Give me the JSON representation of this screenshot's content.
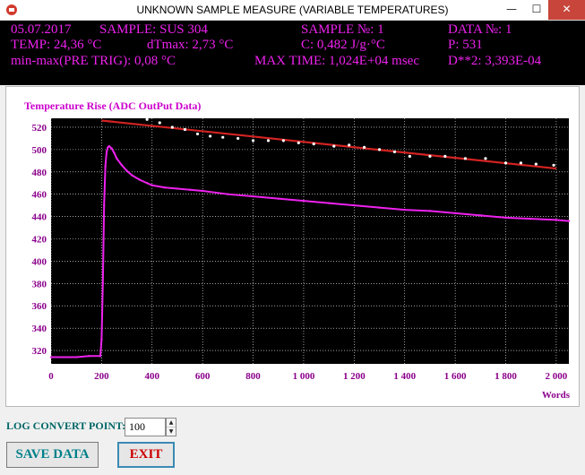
{
  "window": {
    "title": "UNKNOWN SAMPLE MEASURE (VARIABLE TEMPERATURES)",
    "controls": {
      "minimize": "—",
      "maximize": "☐",
      "close": "✕"
    }
  },
  "info": {
    "date": "05.07.2017",
    "sample": "SAMPLE: SUS 304",
    "sample_no": "SAMPLE №: 1",
    "data_no": "DATA №: 1",
    "temp": "TEMP: 24,36 °C",
    "dtmax": "dTmax: 2,73 °C",
    "c": "C: 0,482 J/g·°C",
    "p": "P: 531",
    "minmax": "min-max(PRE TRIG): 0,08 °C",
    "max_time": "MAX TIME: 1,024E+04 msec",
    "d2": "D**2: 3,393E-04"
  },
  "colors": {
    "info_text": "#ee22ee",
    "plot_bg": "#000000",
    "grid": "#ffffff",
    "signal": "#ee22ee",
    "fit_line": "#d42222",
    "fit_points": "#ffffff",
    "axis_label": "#8b008b"
  },
  "chart_data": {
    "type": "scatter",
    "title": "Temperature Rise (ADC OutPut Data)",
    "xlabel": "Words",
    "ylabel": "",
    "xlim": [
      0,
      2050
    ],
    "ylim": [
      308,
      528
    ],
    "xticks": [
      0,
      200,
      400,
      600,
      800,
      1000,
      1200,
      1400,
      1600,
      1800,
      2000
    ],
    "xtick_labels": [
      "0",
      "200",
      "400",
      "600",
      "800",
      "1 000",
      "1 200",
      "1 400",
      "1 600",
      "1 800",
      "2 000"
    ],
    "yticks": [
      320,
      340,
      360,
      380,
      400,
      420,
      440,
      460,
      480,
      500,
      520
    ],
    "ytick_labels": [
      "320",
      "340",
      "360",
      "380",
      "400",
      "420",
      "440",
      "460",
      "480",
      "500",
      "520"
    ],
    "grid": true,
    "series": [
      {
        "style": "signal",
        "x": [
          0,
          50,
          100,
          150,
          195,
          200,
          205,
          210,
          215,
          220,
          225,
          230,
          240,
          250,
          260,
          280,
          300,
          320,
          350,
          380,
          400,
          450,
          500,
          550,
          600,
          700,
          800,
          900,
          1000,
          1100,
          1200,
          1300,
          1400,
          1500,
          1600,
          1700,
          1800,
          1900,
          2000,
          2050
        ],
        "y": [
          314,
          314,
          314,
          315,
          315,
          330,
          380,
          450,
          485,
          498,
          502,
          503,
          501,
          497,
          492,
          486,
          481,
          477,
          473,
          470,
          468,
          466,
          465,
          464,
          463,
          460,
          458,
          456,
          454,
          452,
          450,
          448,
          446,
          445,
          443,
          441,
          439,
          438,
          437,
          436
        ]
      },
      {
        "style": "fit-line",
        "x": [
          200,
          2000
        ],
        "y": [
          526,
          483
        ]
      },
      {
        "style": "fit-points",
        "x": [
          330,
          380,
          430,
          480,
          530,
          580,
          630,
          680,
          740,
          800,
          860,
          920,
          980,
          1040,
          1120,
          1180,
          1240,
          1300,
          1360,
          1420,
          1500,
          1560,
          1640,
          1720,
          1800,
          1860,
          1920,
          1990
        ],
        "y": [
          533,
          527,
          524,
          520,
          518,
          514,
          512,
          511,
          510,
          508,
          508,
          508,
          506,
          505,
          503,
          504,
          502,
          500,
          498,
          494,
          494,
          494,
          492,
          492,
          488,
          488,
          487,
          486
        ]
      }
    ]
  },
  "controls": {
    "log_label": "LOG CONVERT POINT:",
    "log_value": "100",
    "save_label": "SAVE DATA",
    "exit_label": "EXIT",
    "stepper_up": "▲",
    "stepper_down": "▼"
  }
}
